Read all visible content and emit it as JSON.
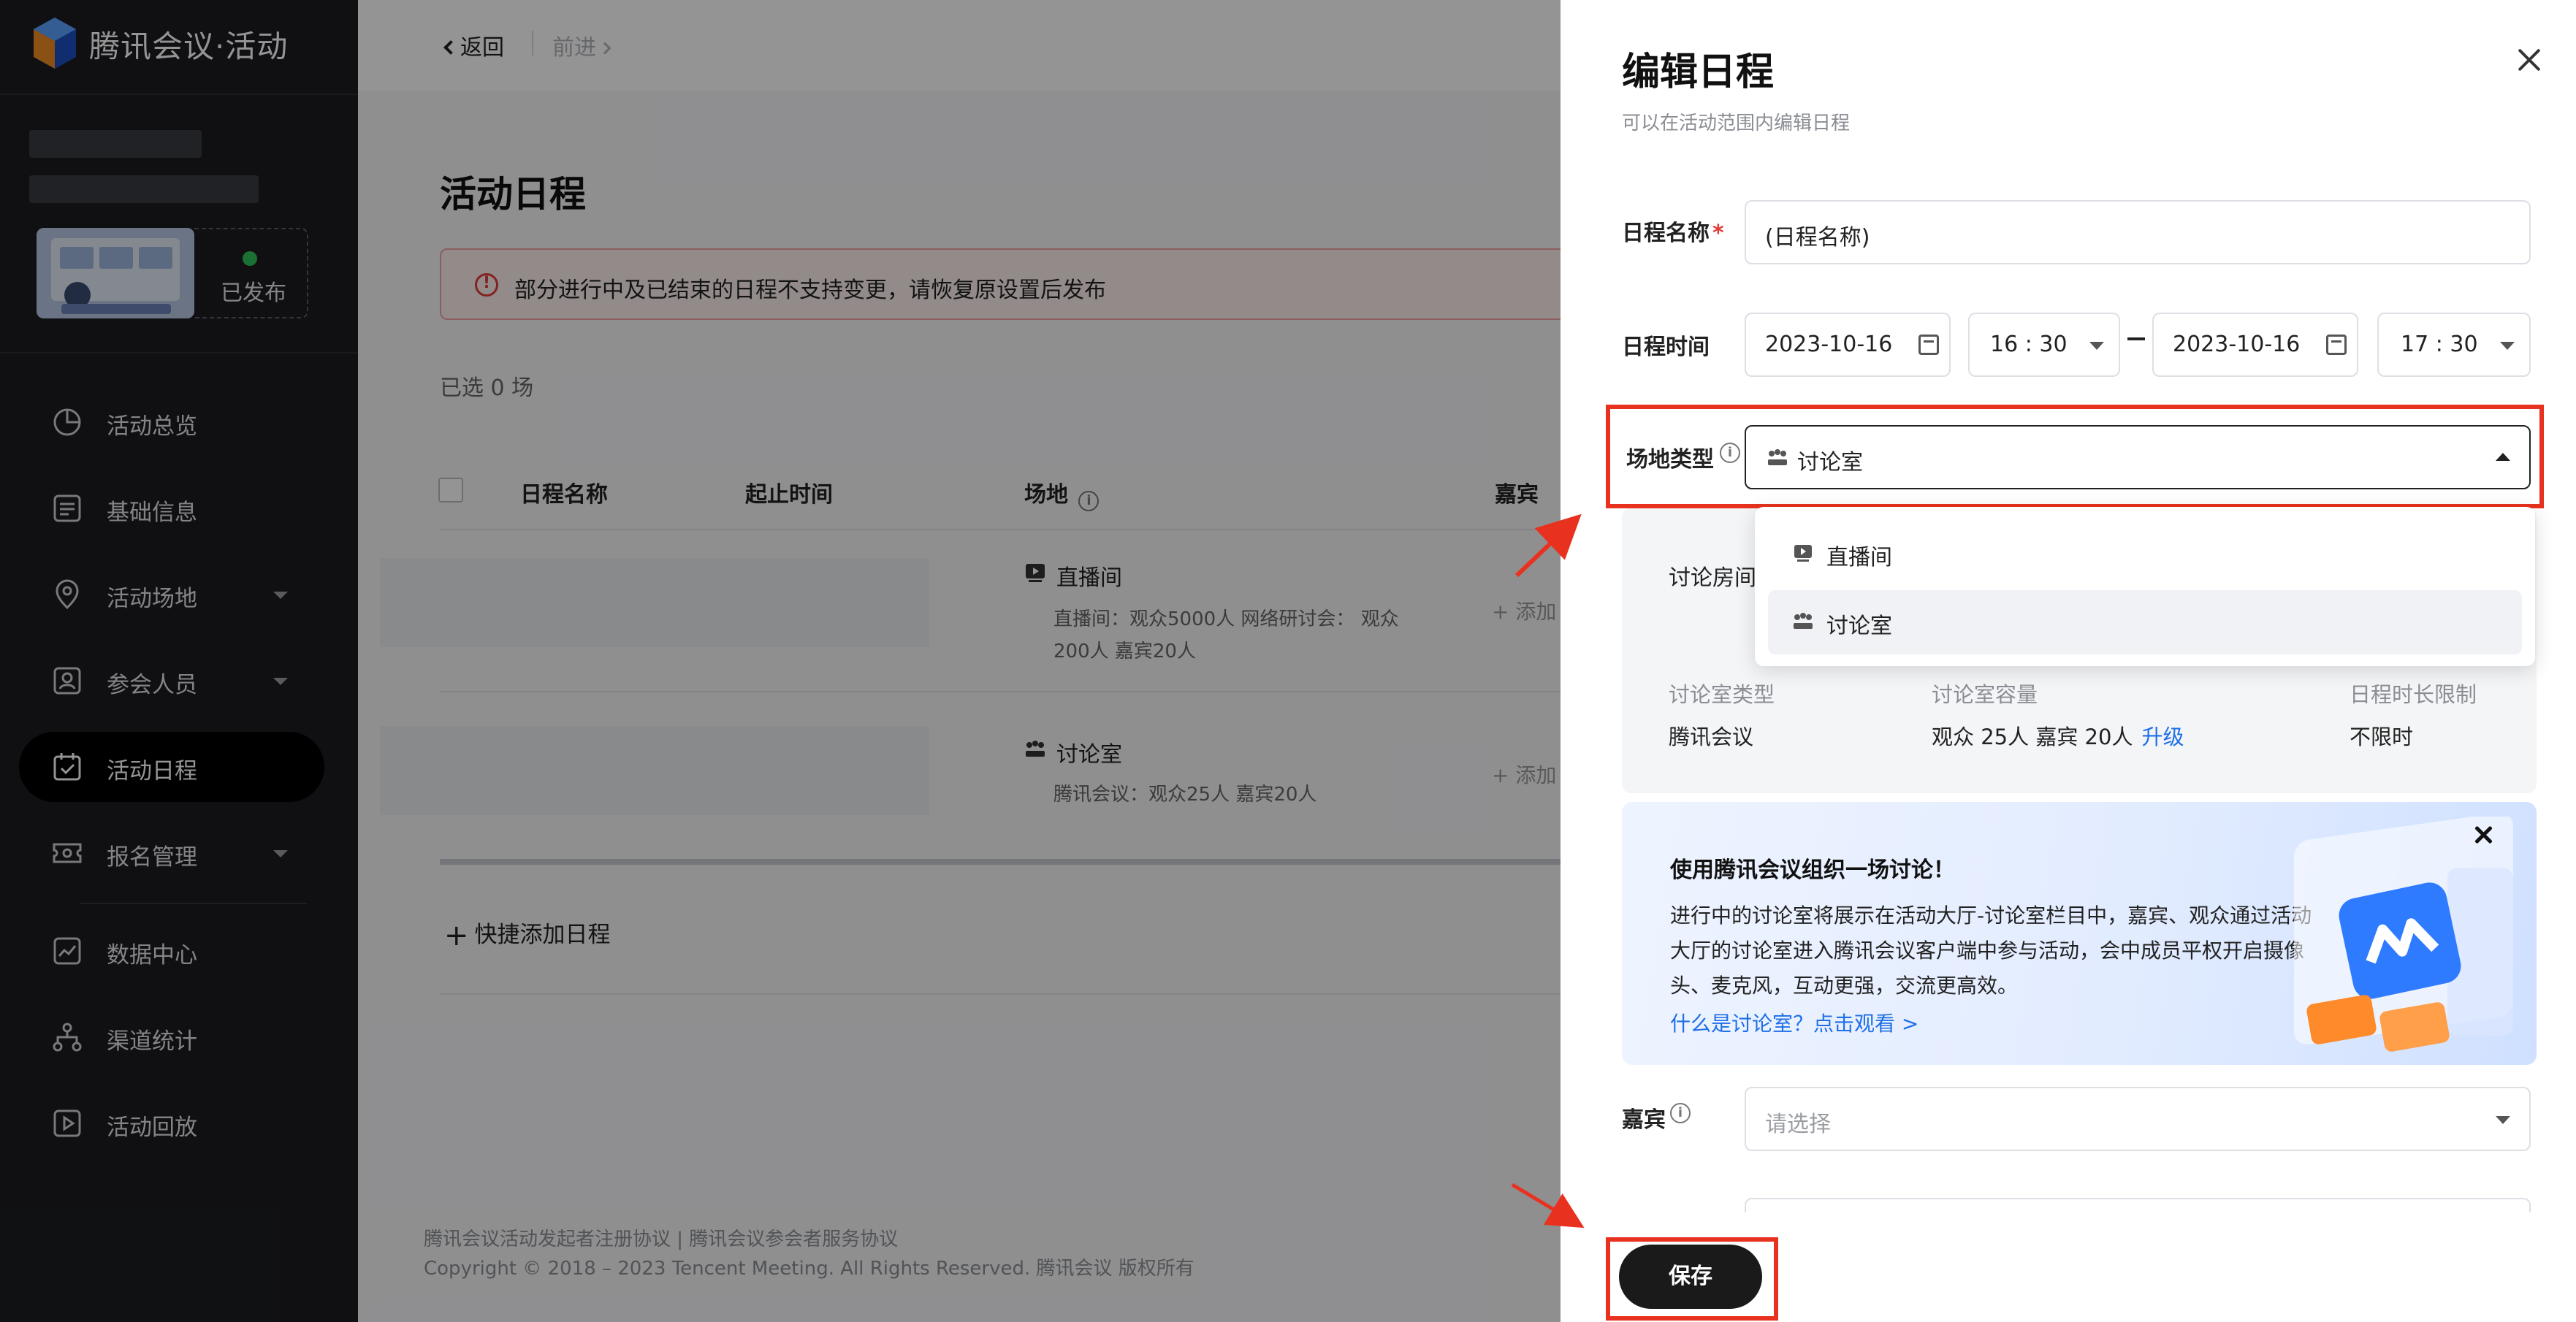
{
  "app": {
    "logo_text": "腾讯会议·活动"
  },
  "sidebar": {
    "publish_status": "已发布",
    "items": [
      {
        "label": "活动总览",
        "icon": "pie-chart-icon",
        "has_arrow": false,
        "active": false
      },
      {
        "label": "基础信息",
        "icon": "form-list-icon",
        "has_arrow": false,
        "active": false
      },
      {
        "label": "活动场地",
        "icon": "location-pin-icon",
        "has_arrow": true,
        "active": false
      },
      {
        "label": "参会人员",
        "icon": "person-badge-icon",
        "has_arrow": true,
        "active": false
      },
      {
        "label": "活动日程",
        "icon": "calendar-check-icon",
        "has_arrow": false,
        "active": true
      },
      {
        "label": "报名管理",
        "icon": "ticket-icon",
        "has_arrow": true,
        "active": false
      },
      {
        "label": "数据中心",
        "icon": "line-chart-icon",
        "has_arrow": false,
        "active": false
      },
      {
        "label": "渠道统计",
        "icon": "org-tree-icon",
        "has_arrow": false,
        "active": false
      },
      {
        "label": "活动回放",
        "icon": "play-box-icon",
        "has_arrow": false,
        "active": false
      }
    ]
  },
  "topbar": {
    "back_label": "返回",
    "forward_label": "前进"
  },
  "main": {
    "title": "活动日程",
    "alert_text": "部分进行中及已结束的日程不支持变更，请恢复原设置后发布",
    "selected_count": "已选 0 场",
    "columns": [
      "日程名称",
      "起止时间",
      "场地",
      "嘉宾"
    ],
    "rows": [
      {
        "venue": "直播间",
        "desc_line1": "直播间：观众5000人 网络研讨会： 观众",
        "desc_line2": "200人 嘉宾20人",
        "add_label": "+ 添加"
      },
      {
        "venue": "讨论室",
        "desc_line1": "腾讯会议：观众25人 嘉宾20人",
        "desc_line2": "",
        "add_label": "+ 添加"
      }
    ],
    "quick_add": "快捷添加日程",
    "footer_line1": "腾讯会议活动发起者注册协议 | 腾讯会议参会者服务协议",
    "footer_line2": "Copyright © 2018 – 2023 Tencent Meeting. All Rights Reserved. 腾讯会议 版权所有"
  },
  "drawer": {
    "title": "编辑日程",
    "subtitle": "可以在活动范围内编辑日程",
    "fields": {
      "name_label": "日程名称",
      "name_value": "(日程名称)",
      "time_label": "日程时间",
      "start_date": "2023-10-16",
      "start_time": "16 : 30",
      "end_date": "2023-10-16",
      "end_time": "17 : 30",
      "venue_type_label": "场地类型",
      "venue_type_value": "讨论室",
      "guest_label": "嘉宾",
      "guest_placeholder": "请选择"
    },
    "dropdown_options": [
      "直播间",
      "讨论室"
    ],
    "dropdown_selected": "讨论室",
    "room": {
      "label": "讨论房间",
      "type_header": "讨论室类型",
      "type_value": "腾讯会议",
      "capacity_header": "讨论室容量",
      "capacity_value": "观众 25人 嘉宾 20人",
      "upgrade_link": "升级",
      "limit_header": "日程时长限制",
      "limit_value": "不限时"
    },
    "promo": {
      "title": "使用腾讯会议组织一场讨论！",
      "body": "进行中的讨论室将展示在活动大厅-讨论室栏目中，嘉宾、观众通过活动大厅的讨论室进入腾讯会议客户端中参与活动，会中成员平权开启摄像头、麦克风，互动更强，交流更高效。",
      "link": "什么是讨论室？点击观看 >"
    },
    "save_label": "保存"
  },
  "colors": {
    "accent_blue": "#1f6fe8",
    "highlight_red": "#e8321f",
    "sidebar_bg": "#1c1d21",
    "publish_green": "#2fc35a"
  }
}
